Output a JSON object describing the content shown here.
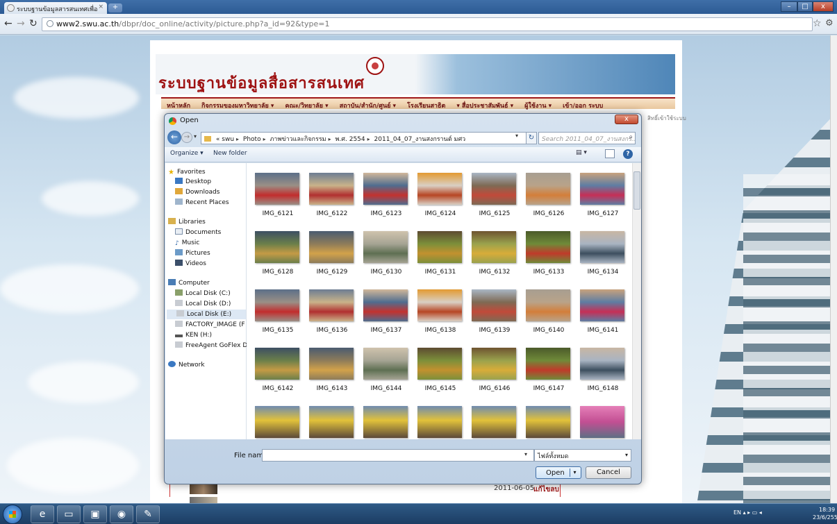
{
  "browser": {
    "tab_title": "ระบบฐานข้อมูลสารสนเทศเพื่อ",
    "tab_close": "×",
    "new_tab": "+",
    "url_host": "www2.swu.ac.th",
    "url_path": "/dbpr/doc_online/activity/picture.php?a_id=92&type=1",
    "window_controls": {
      "minimize": "–",
      "maximize": "□",
      "close": "x"
    },
    "icons": [
      "back-arrow-icon",
      "forward-arrow-icon",
      "reload-icon",
      "star-icon",
      "wrench-icon"
    ]
  },
  "site": {
    "title": "ระบบฐานข้อมูลสื่อสารสนเทศ",
    "nav": [
      "หน้าหลัก",
      "กิจกรรมของมหาวิทยาลัย ▾",
      "คณะ/วิทยาลัย ▾",
      "สถาบัน/สำนัก/ศูนย์ ▾",
      "โรงเรียนสาธิต",
      "▾ สื่อประชาสัมพันธ์ ▾",
      "ผู้ใช้งาน ▾",
      "เข้า/ออก ระบบ"
    ],
    "aside_text": "สิทธิ์เข้าใช้ระบบ",
    "row_date": "2011-06-05",
    "row_action": "แก้ไขลบ"
  },
  "dialog": {
    "title": "Open",
    "close": "x",
    "breadcrumb": [
      "«",
      "swu",
      "Photo",
      "ภาพข่าวและกิจกรรม",
      "พ.ศ. 2554",
      "2011_04_07_งานสงกรานต์ มศว"
    ],
    "search_placeholder": "Search 2011_04_07_งานสงกร...",
    "organize_label": "Organize ▾",
    "new_folder_label": "New folder",
    "nav_pane": {
      "favorites_header": "Favorites",
      "favorites": [
        "Desktop",
        "Downloads",
        "Recent Places"
      ],
      "libraries_header": "Libraries",
      "libraries": [
        "Documents",
        "Music",
        "Pictures",
        "Videos"
      ],
      "computer_header": "Computer",
      "drives": [
        "Local Disk (C:)",
        "Local Disk (D:)",
        "Local Disk (E:)",
        "FACTORY_IMAGE (F",
        "KEN (H:)",
        "FreeAgent GoFlex Dr"
      ],
      "selected_drive_index": 2,
      "network": "Network"
    },
    "files": [
      "IMG_6121",
      "IMG_6122",
      "IMG_6123",
      "IMG_6124",
      "IMG_6125",
      "IMG_6126",
      "IMG_6127",
      "IMG_6128",
      "IMG_6129",
      "IMG_6130",
      "IMG_6131",
      "IMG_6132",
      "IMG_6133",
      "IMG_6134",
      "IMG_6135",
      "IMG_6136",
      "IMG_6137",
      "IMG_6138",
      "IMG_6139",
      "IMG_6140",
      "IMG_6141",
      "IMG_6142",
      "IMG_6143",
      "IMG_6144",
      "IMG_6145",
      "IMG_6146",
      "IMG_6147",
      "IMG_6148"
    ],
    "file_name_label": "File name:",
    "file_name_value": "",
    "filter_value": "ไฟล์ทั้งหมด",
    "open_label": "Open",
    "cancel_label": "Cancel"
  },
  "taskbar": {
    "apps": [
      "ie-icon",
      "explorer-icon",
      "app-icon",
      "chrome-icon",
      "paint-icon"
    ],
    "tray": "EN  ▴  ▸  ▭  ◂",
    "time": "18:39",
    "date": "23/6/2554"
  }
}
